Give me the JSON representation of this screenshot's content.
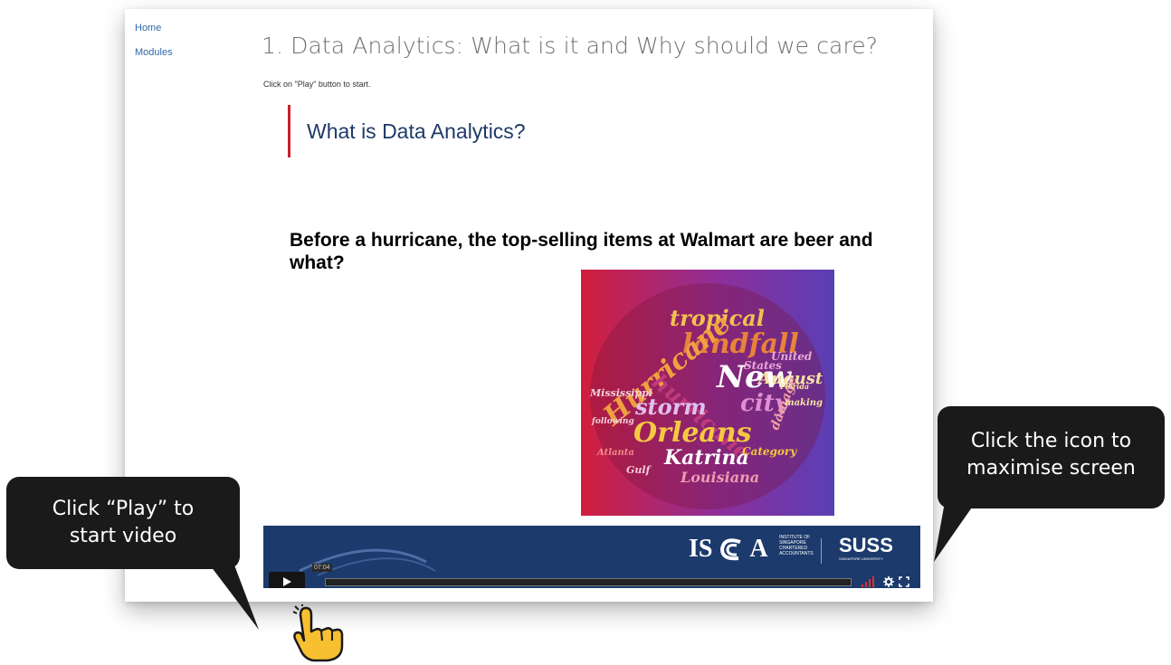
{
  "nav": {
    "home": "Home",
    "modules": "Modules"
  },
  "page": {
    "title": "1. Data Analytics: What is it and Why should we care?",
    "instruction": "Click on \"Play\" button to start."
  },
  "slide": {
    "heading": "What is Data Analytics?",
    "question": "Before a hurricane, the top-selling items at Walmart are beer and what?",
    "wordcloud_words": [
      "tropical",
      "landfall",
      "Hurricane",
      "hurricane",
      "New",
      "August",
      "city",
      "Mississippi",
      "storm",
      "Orleans",
      "damage",
      "Katrina",
      "Category",
      "Atlanta",
      "Louisiana",
      "Florida",
      "making",
      "following",
      "United",
      "States",
      "Gulf"
    ]
  },
  "logos": {
    "isca_mark": "IS",
    "isca_tail": "A",
    "isca_subtitle": [
      "INSTITUTE OF",
      "SINGAPORE",
      "CHARTERED",
      "ACCOUNTANTS"
    ],
    "suss": "SUSS",
    "suss_subtitle": "SINGAPORE UNIVERSITY"
  },
  "player": {
    "time": "07:04",
    "play_icon": "play-icon",
    "volume_icon": "volume-bars-icon",
    "settings_icon": "gear-icon",
    "fullscreen_icon": "fullscreen-icon"
  },
  "callouts": {
    "left": [
      "Click “Play” to",
      "start video"
    ],
    "right": [
      "Click the icon to",
      "maximise screen"
    ]
  },
  "colors": {
    "accent_red": "#c8202e",
    "slide_heading": "#1f3a68",
    "footer_band": "#1c3a6b",
    "link": "#2f6aa8",
    "callout_bg": "#1a1a1a",
    "hand": "#f7c031"
  }
}
